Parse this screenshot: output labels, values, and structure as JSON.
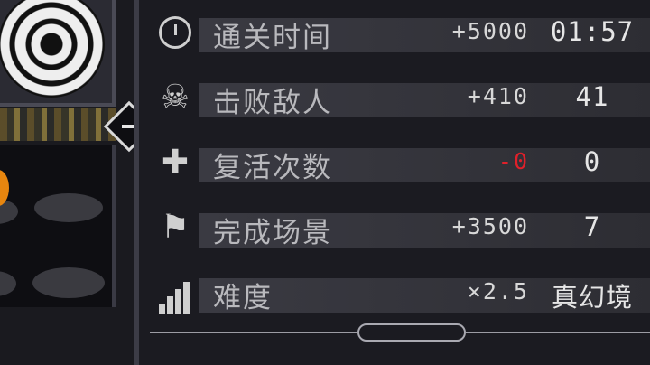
{
  "stats": [
    {
      "label": "通关时间",
      "bonus": "+5000",
      "value": "01:57",
      "icon": "clock-icon",
      "bonus_color": "#d8d8d8"
    },
    {
      "label": "击败敌人",
      "bonus": "+410",
      "value": "41",
      "icon": "skull-icon",
      "bonus_color": "#d8d8d8"
    },
    {
      "label": "复活次数",
      "bonus": "-0",
      "value": "0",
      "icon": "tombstone-cross-icon",
      "bonus_color": "#e0202a"
    },
    {
      "label": "完成场景",
      "bonus": "+3500",
      "value": "7",
      "icon": "flag-icon",
      "bonus_color": "#d8d8d8"
    },
    {
      "label": "难度",
      "bonus": "×2.5",
      "value": "真幻境",
      "icon": "difficulty-bars-icon",
      "bonus_color": "#d8d8d8"
    }
  ],
  "collapse_symbol": "−"
}
